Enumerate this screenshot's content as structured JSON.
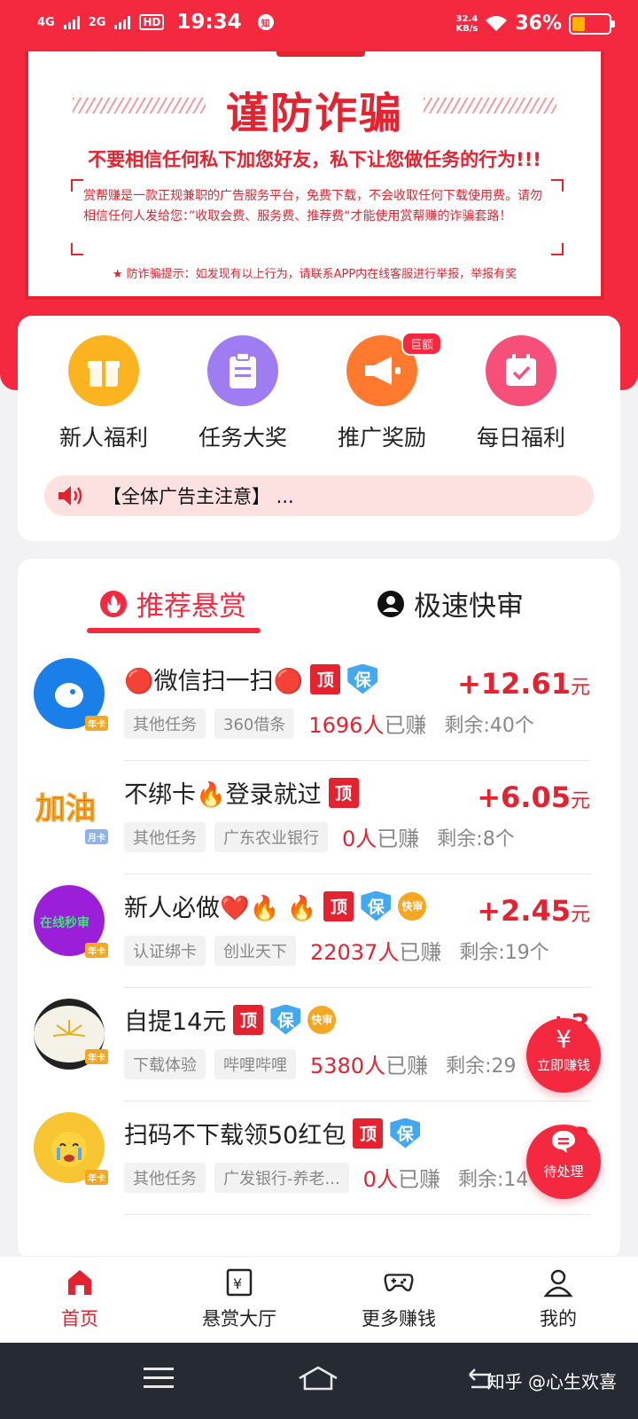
{
  "status_bar": {
    "net1": "4G",
    "net2": "2G",
    "hd": "HD",
    "time": "19:34",
    "notif": "知",
    "speed_top": "32.4",
    "speed_unit": "KB/s",
    "battery_pct": "36%",
    "battery_level": 0.36
  },
  "warning": {
    "title": "谨防诈骗",
    "subtitle": "不要相信任何私下加您好友，私下让您做任务的行为!!!",
    "body": "赏帮赚是一款正规兼职的广告服务平台，免费下载，不会收取任何下载使用费。请勿相信任何人发给您：”收取会费、服务费、推荐费“才能使用赏帮赚的诈骗套路！",
    "tip": "★ 防诈骗提示：如发现有以上行为，请联系APP内在线客服进行举报，举报有奖"
  },
  "quick": {
    "items": [
      {
        "label": "新人福利",
        "icon": "gift-icon",
        "color": "#fbb320"
      },
      {
        "label": "任务大奖",
        "icon": "clipboard-icon",
        "color": "#a07cf2"
      },
      {
        "label": "推广奖励",
        "icon": "megaphone-icon",
        "color": "#ff7a2e",
        "badge": "巨额"
      },
      {
        "label": "每日福利",
        "icon": "calendar-icon",
        "color": "#f6507a"
      }
    ],
    "notice": "【全体广告主注意】 ..."
  },
  "tabs": {
    "recommend": "推荐悬赏",
    "fast": "极速快审"
  },
  "tasks": [
    {
      "title": "🔴微信扫一扫🔴",
      "flags": [
        "顶",
        "保"
      ],
      "price": "+12.61",
      "unit": "元",
      "chips": [
        "其他任务",
        "360借条"
      ],
      "earned_num": "1696人",
      "earned_txt": "已赚",
      "remain": "剩余:40个",
      "avatar_color": "#1a7fe8",
      "crown": "年卡"
    },
    {
      "title": "不绑卡🔥登录就过",
      "flags": [
        "顶"
      ],
      "price": "+6.05",
      "unit": "元",
      "chips": [
        "其他任务",
        "广东农业银行"
      ],
      "earned_num": "0人",
      "earned_txt": "已赚",
      "remain": "剩余:8个",
      "avatar_color": "#ffffff",
      "crown": "月卡"
    },
    {
      "title": "新人必做❤️🔥 🔥",
      "flags": [
        "顶",
        "保",
        "快审"
      ],
      "price": "+2.45",
      "unit": "元",
      "chips": [
        "认证绑卡",
        "创业天下"
      ],
      "earned_num": "22037人",
      "earned_txt": "已赚",
      "remain": "剩余:19个",
      "avatar_color": "#9b1fd8",
      "crown": "年卡"
    },
    {
      "title": "自提14元",
      "flags": [
        "顶",
        "保",
        "快审"
      ],
      "price": "+3",
      "unit": "",
      "chips": [
        "下载体验",
        "哔哩哔哩"
      ],
      "earned_num": "5380人",
      "earned_txt": "已赚",
      "remain": "剩余:29",
      "avatar_color": "#333333",
      "crown": "年卡"
    },
    {
      "title": "扫码不下载领50红包",
      "flags": [
        "顶",
        "保"
      ],
      "price": "+3",
      "unit": "",
      "chips": [
        "其他任务",
        "广发银行-养老..."
      ],
      "earned_num": "0人",
      "earned_txt": "已赚",
      "remain": "剩余:14",
      "avatar_color": "#f7c531",
      "crown": "年卡"
    }
  ],
  "float": {
    "earn_label": "立即赚钱",
    "earn_icon": "¥",
    "pending_label": "待处理"
  },
  "tabbar": [
    {
      "label": "首页",
      "icon": "home-icon",
      "active": true
    },
    {
      "label": "悬赏大厅",
      "icon": "reward-hall-icon"
    },
    {
      "label": "更多赚钱",
      "icon": "gamepad-icon"
    },
    {
      "label": "我的",
      "icon": "profile-icon"
    }
  ],
  "watermark": "知乎 @心生欢喜",
  "colors": {
    "brand_red": "#f4283f",
    "warn_red": "#e42230",
    "blue_shield": "#42a8f0"
  }
}
